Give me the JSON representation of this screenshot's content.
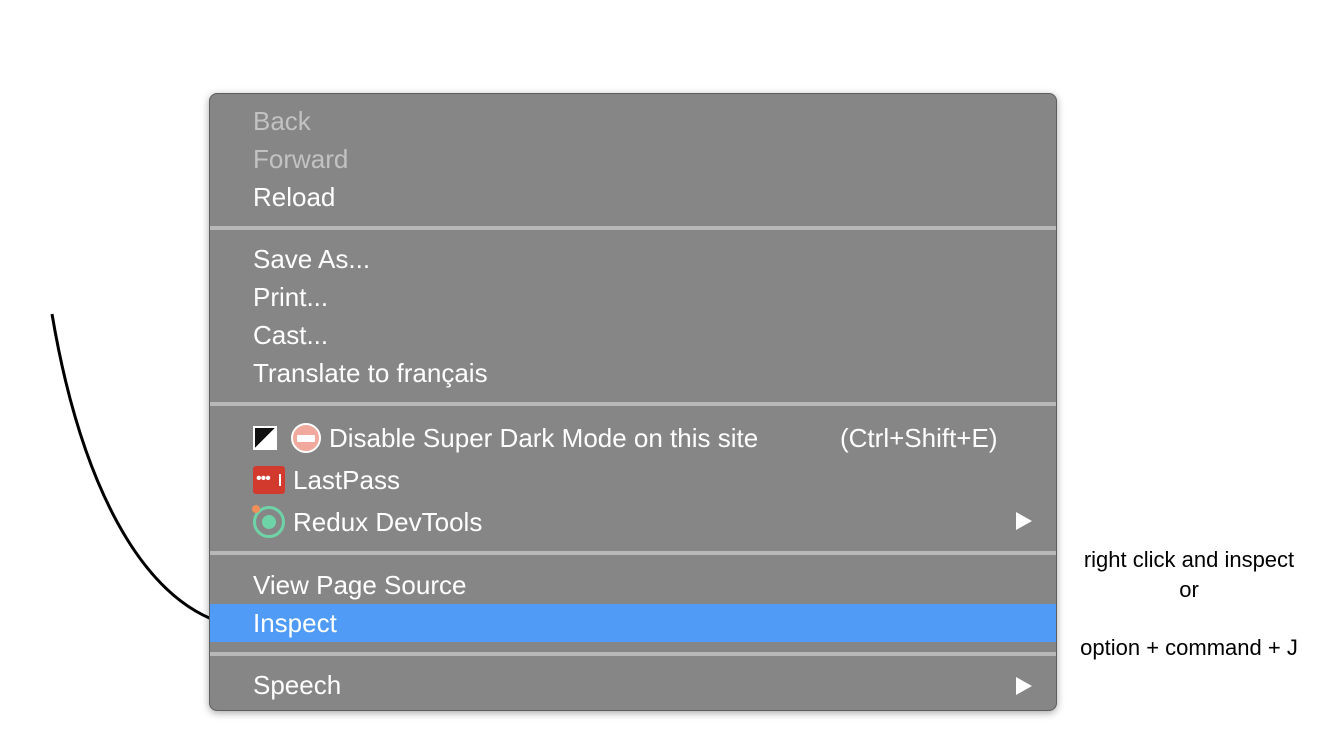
{
  "menu": {
    "items": [
      {
        "label": "Back",
        "enabled": false
      },
      {
        "label": "Forward",
        "enabled": false
      },
      {
        "label": "Reload",
        "enabled": true
      },
      {
        "label": "Save As...",
        "enabled": true
      },
      {
        "label": "Print...",
        "enabled": true
      },
      {
        "label": "Cast...",
        "enabled": true
      },
      {
        "label": "Translate to français",
        "enabled": true
      },
      {
        "label": "Disable Super Dark Mode on this site",
        "shortcut": "(Ctrl+Shift+E)",
        "icons": [
          "contrast-icon",
          "disable-icon"
        ]
      },
      {
        "label": "LastPass",
        "icons": [
          "lastpass-icon"
        ]
      },
      {
        "label": "Redux DevTools",
        "icons": [
          "redux-devtools-icon"
        ],
        "submenu": true
      },
      {
        "label": "View Page Source",
        "enabled": true
      },
      {
        "label": "Inspect",
        "highlighted": true
      },
      {
        "label": "Speech",
        "submenu": true
      }
    ]
  },
  "annotation": {
    "line1": "right click and inspect",
    "line2": "or",
    "line3": "option + command + J"
  },
  "colors": {
    "menu_bg": "#868686",
    "highlight": "#4f9bf5",
    "separator": "#b8b8b8"
  }
}
